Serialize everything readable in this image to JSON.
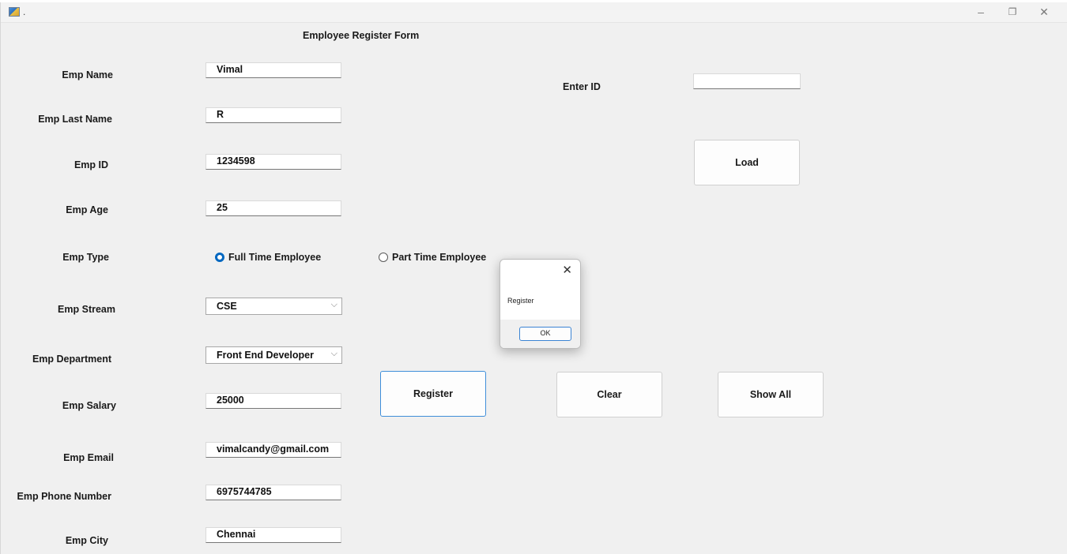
{
  "window": {
    "title": ".",
    "minimize_glyph": "–",
    "restore_glyph": "❐",
    "close_glyph": "✕"
  },
  "form": {
    "title": "Employee Register Form",
    "labels": {
      "name": "Emp Name",
      "last_name": "Emp Last Name",
      "id": "Emp ID",
      "age": "Emp  Age",
      "type": "Emp Type",
      "stream": "Emp Stream",
      "department": "Emp Department",
      "salary": "Emp Salary",
      "email": "Emp Email",
      "phone": "Emp Phone Number",
      "city": "Emp City",
      "enter_id": "Enter ID"
    },
    "values": {
      "name": "Vimal",
      "last_name": "R",
      "id": "1234598",
      "age": "25",
      "stream": "CSE",
      "department": "Front End Developer",
      "salary": "25000",
      "email": "vimalcandy@gmail.com",
      "phone": "6975744785",
      "city": "Chennai",
      "enter_id": ""
    },
    "radios": {
      "full_time": "Full Time Employee",
      "part_time": "Part Time Employee",
      "selected": "full_time"
    },
    "buttons": {
      "load": "Load",
      "register": "Register",
      "clear": "Clear",
      "show_all": "Show All"
    }
  },
  "dialog": {
    "message": "Register",
    "ok": "OK",
    "close_glyph": "✕"
  },
  "colors": {
    "accent": "#0067c0",
    "window_bg": "#f0f0f0"
  }
}
